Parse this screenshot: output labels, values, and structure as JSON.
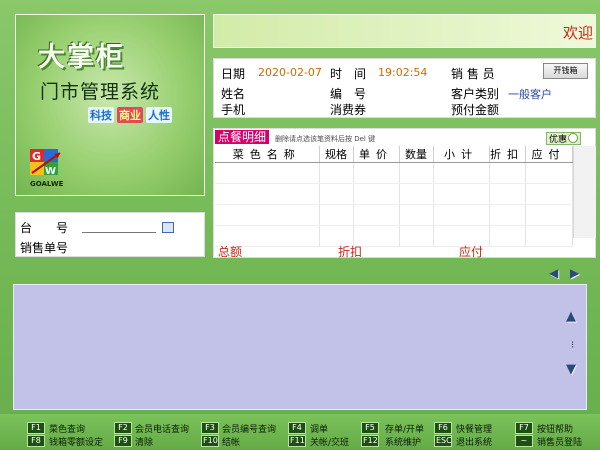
{
  "logo": {
    "brand": "大掌柜",
    "system": "门市管理系统",
    "tags": [
      "科技",
      "商业",
      "人性"
    ],
    "mark_text": "GOALWE"
  },
  "welcome": {
    "text": "欢迎"
  },
  "info": {
    "date_label": "日期",
    "date_value": "2020-02-07",
    "time_label": "时　间",
    "time_value": "19:02:54",
    "salesperson_label": "销 售 员",
    "open_drawer": "开钱箱",
    "name_label": "姓名",
    "number_label": "编　号",
    "customer_type_label": "客户类别",
    "customer_type_value": "一般客户",
    "phone_label": "手机",
    "voucher_label": "消费券",
    "prepaid_label": "预付金额"
  },
  "detail": {
    "title": "点餐明细",
    "hint": "删除请点选该笔资料后按 Del 键",
    "option": "优惠",
    "columns": [
      "菜色名称",
      "规格",
      "单价",
      "数量",
      "小计",
      "折扣",
      "应付"
    ],
    "total_label": "总额",
    "discount_label": "折扣",
    "payable_label": "应付"
  },
  "table_no": {
    "table_label": "台　　号",
    "sale_no_label": "销售单号"
  },
  "footer": {
    "keys": [
      {
        "key": "F1",
        "label": "菜色查询"
      },
      {
        "key": "F2",
        "label": "会员电话查询"
      },
      {
        "key": "F3",
        "label": "会员编号查询"
      },
      {
        "key": "F4",
        "label": "调单"
      },
      {
        "key": "F5",
        "label": "存单/开单"
      },
      {
        "key": "F6",
        "label": "快餐管理"
      },
      {
        "key": "F7",
        "label": "按钮帮助"
      },
      {
        "key": "F8",
        "label": "钱箱零额设定"
      },
      {
        "key": "F9",
        "label": "清除"
      },
      {
        "key": "F10",
        "label": "结帐"
      },
      {
        "key": "F11",
        "label": "关帐/交班"
      },
      {
        "key": "F12",
        "label": "系统维护"
      },
      {
        "key": "ESC",
        "label": "退出系统"
      },
      {
        "key": "~",
        "label": "销售员登陆"
      }
    ]
  },
  "colors": {
    "accent_red": "#c8281c",
    "value_orange": "#d06a00",
    "title_magenta": "#d6006a"
  }
}
